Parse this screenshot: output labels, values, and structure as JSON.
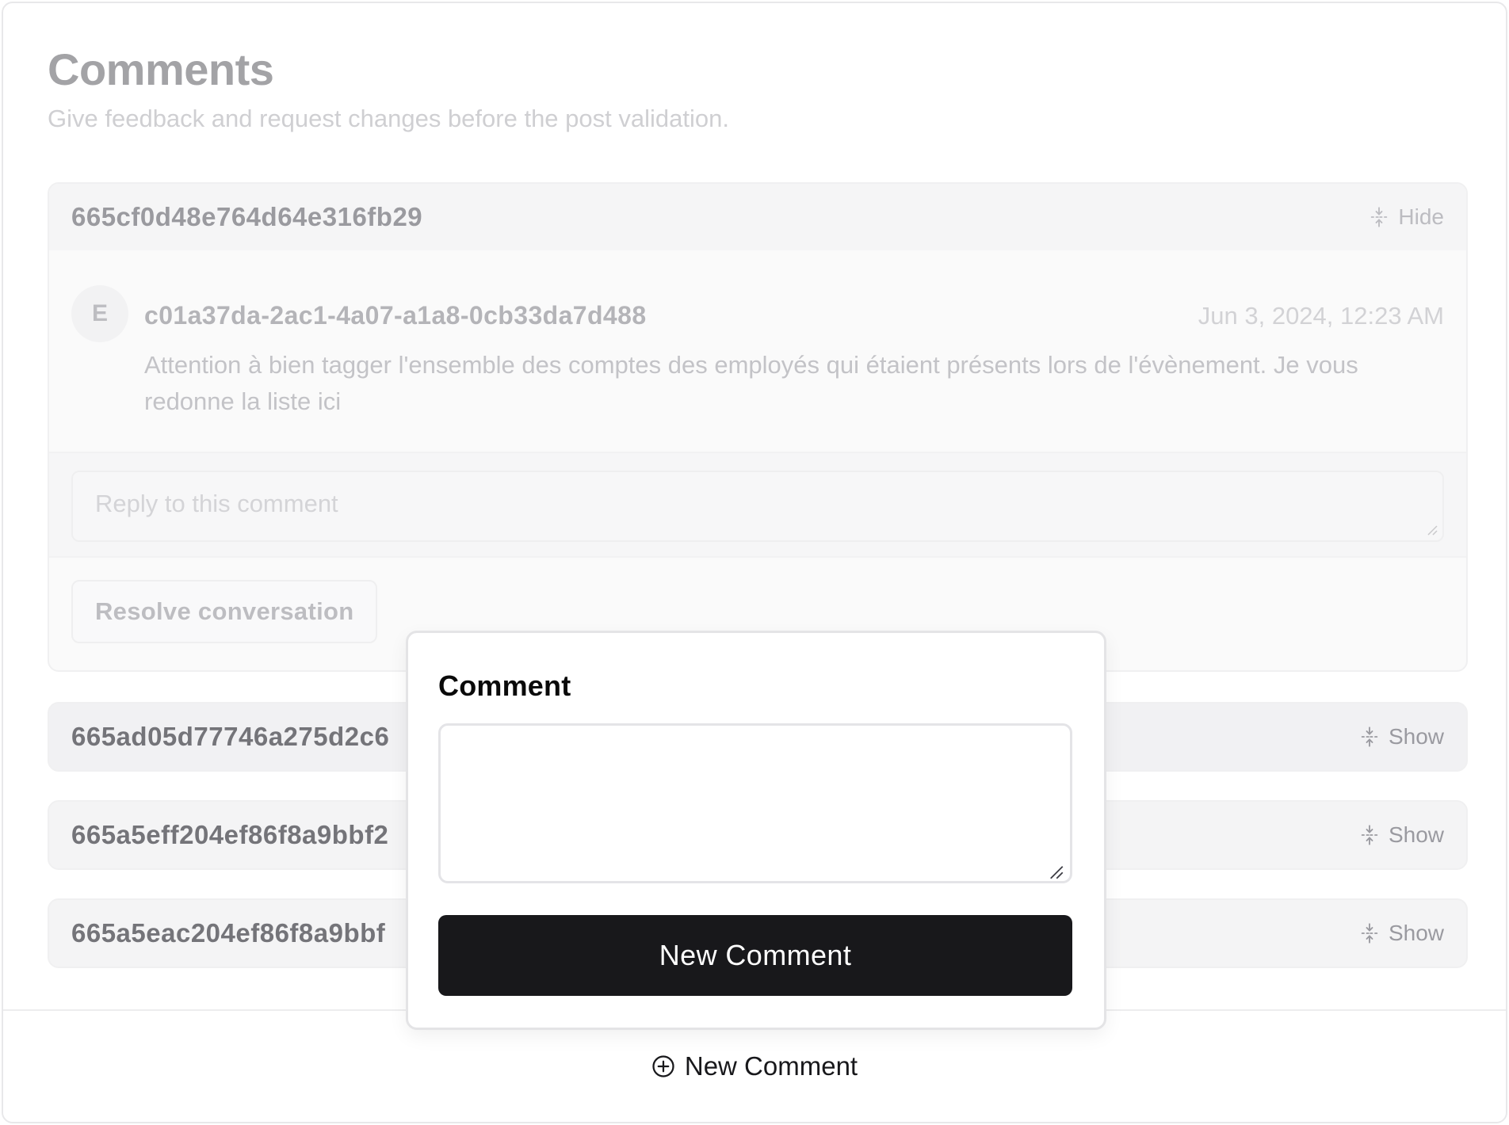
{
  "header": {
    "title": "Comments",
    "subtitle": "Give feedback and request changes before the post validation."
  },
  "threads": [
    {
      "id": "665cf0d48e764d64e316fb29",
      "toggle_label": "Hide",
      "expanded": true,
      "comment": {
        "avatar_initial": "E",
        "author": "c01a37da-2ac1-4a07-a1a8-0cb33da7d488",
        "date": "Jun 3, 2024, 12:23 AM",
        "message": "Attention à bien tagger l'ensemble des comptes des employés qui étaient présents lors de l'évènement. Je vous redonne la liste ici"
      },
      "reply_placeholder": "Reply to this comment",
      "resolve_label": "Resolve conversation"
    },
    {
      "id": "665ad05d77746a275d2c6",
      "toggle_label": "Show",
      "expanded": false
    },
    {
      "id": "665a5eff204ef86f8a9bbf2",
      "toggle_label": "Show",
      "expanded": false
    },
    {
      "id": "665a5eac204ef86f8a9bbf",
      "toggle_label": "Show",
      "expanded": false
    }
  ],
  "footer": {
    "new_comment_label": "New Comment"
  },
  "popover": {
    "label": "Comment",
    "textarea_value": "",
    "submit_label": "New Comment"
  },
  "icons": {
    "toggle": "unfold-vertical-icon",
    "footer": "plus-circle-icon"
  },
  "colors": {
    "primary_button": "#18181b",
    "primary_text": "#ffffff"
  }
}
